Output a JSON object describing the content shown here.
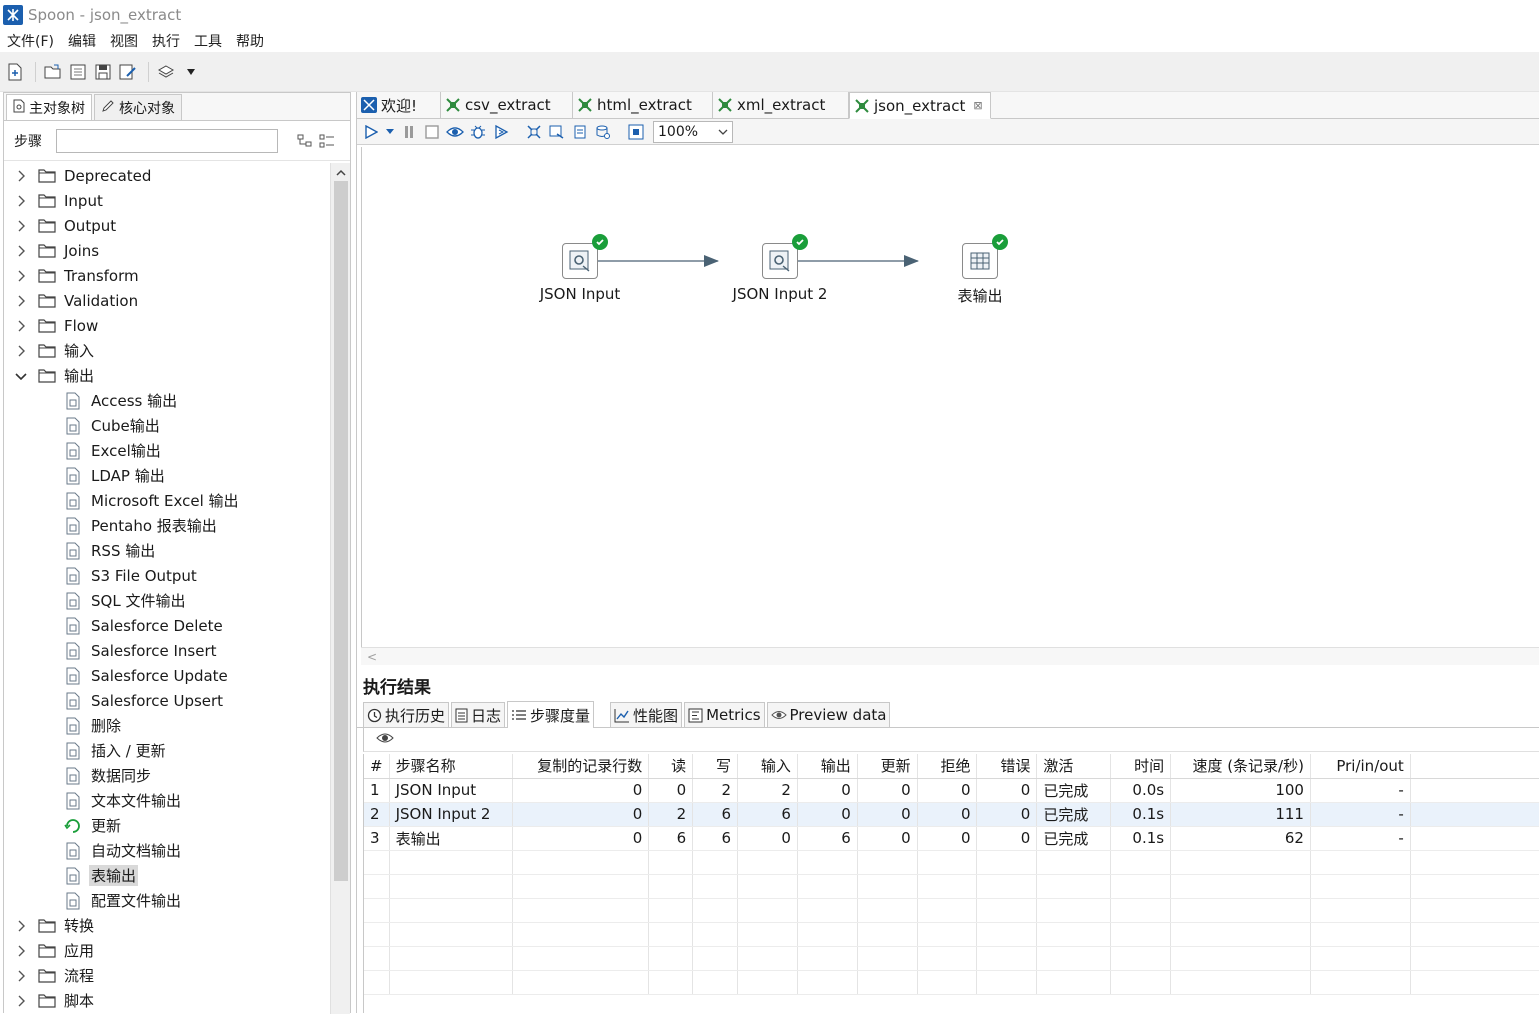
{
  "window": {
    "title": "Spoon - json_extract"
  },
  "menu": [
    "文件(F)",
    "编辑",
    "视图",
    "执行",
    "工具",
    "帮助"
  ],
  "left_panel": {
    "tabs": [
      "主对象树",
      "核心对象"
    ],
    "search_label": "步骤",
    "search_value": "",
    "categories_top": [
      "Deprecated",
      "Input",
      "Output",
      "Joins",
      "Transform",
      "Validation",
      "Flow",
      "输入"
    ],
    "expanded_category": "输出",
    "expanded_items": [
      "Access 输出",
      "Cube输出",
      "Excel输出",
      "LDAP 输出",
      "Microsoft Excel 输出",
      "Pentaho 报表输出",
      "RSS 输出",
      "S3 File Output",
      "SQL 文件输出",
      "Salesforce Delete",
      "Salesforce Insert",
      "Salesforce Update",
      "Salesforce Upsert",
      "删除",
      "插入 / 更新",
      "数据同步",
      "文本文件输出",
      "更新",
      "自动文档输出",
      "表输出",
      "配置文件输出"
    ],
    "selected_item": "表输出",
    "categories_bottom": [
      "转换",
      "应用",
      "流程",
      "脚本"
    ]
  },
  "file_tabs": [
    {
      "label": "欢迎!",
      "active": false
    },
    {
      "label": "csv_extract",
      "active": false
    },
    {
      "label": "html_extract",
      "active": false
    },
    {
      "label": "xml_extract",
      "active": false
    },
    {
      "label": "json_extract",
      "active": true
    }
  ],
  "canvas": {
    "zoom": "100%",
    "nodes": [
      {
        "name": "JSON Input",
        "status": "done"
      },
      {
        "name": "JSON Input 2",
        "status": "done"
      },
      {
        "name": "表输出",
        "status": "done"
      }
    ]
  },
  "results": {
    "title": "执行结果",
    "tabs": [
      "执行历史",
      "日志",
      "步骤度量",
      "性能图",
      "Metrics",
      "Preview data"
    ],
    "active_tab": "步骤度量",
    "columns": [
      "#",
      "步骤名称",
      "复制的记录行数",
      "读",
      "写",
      "输入",
      "输出",
      "更新",
      "拒绝",
      "错误",
      "激活",
      "时间",
      "速度 (条记录/秒)",
      "Pri/in/out"
    ],
    "rows": [
      [
        "1",
        "JSON Input",
        "0",
        "0",
        "2",
        "2",
        "0",
        "0",
        "0",
        "0",
        "已完成",
        "0.0s",
        "100",
        "-"
      ],
      [
        "2",
        "JSON Input 2",
        "0",
        "2",
        "6",
        "6",
        "0",
        "0",
        "0",
        "0",
        "已完成",
        "0.1s",
        "111",
        "-"
      ],
      [
        "3",
        "表输出",
        "0",
        "6",
        "6",
        "0",
        "6",
        "0",
        "0",
        "0",
        "已完成",
        "0.1s",
        "62",
        "-"
      ]
    ]
  },
  "colors": {
    "accent": "#1b5fae",
    "ok": "#1a9e3a",
    "kettle_green": "#2e8b3e",
    "row_highlight": "#eaf2fb"
  }
}
